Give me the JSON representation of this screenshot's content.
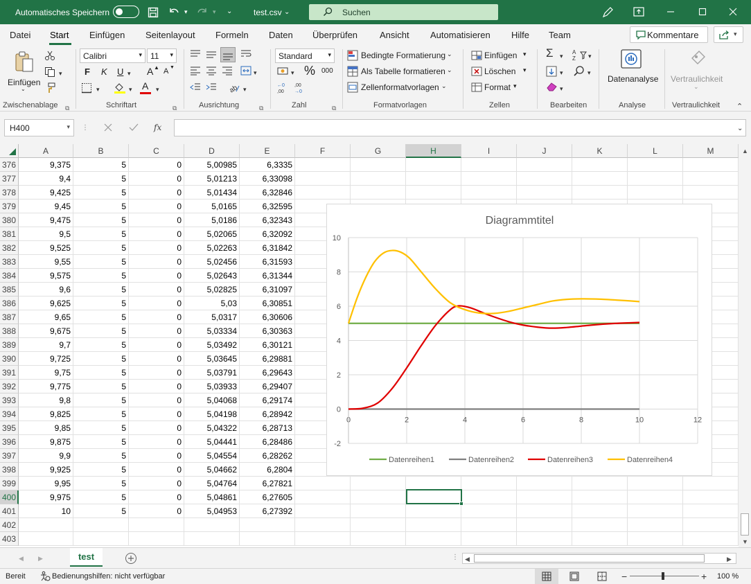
{
  "titlebar": {
    "autosave_label": "Automatisches Speichern",
    "filename": "test.csv",
    "search_placeholder": "Suchen"
  },
  "menu": {
    "items": [
      "Datei",
      "Start",
      "Einfügen",
      "Seitenlayout",
      "Formeln",
      "Daten",
      "Überprüfen",
      "Ansicht",
      "Automatisieren",
      "Hilfe",
      "Team"
    ],
    "active": "Start",
    "comments_label": "Kommentare"
  },
  "ribbon": {
    "clipboard": {
      "paste_label": "Einfügen",
      "group_label": "Zwischenablage"
    },
    "font": {
      "name": "Calibri",
      "size": "11",
      "bold": "F",
      "italic": "K",
      "underline": "U",
      "grow": "A",
      "shrink": "A",
      "color_letter": "A",
      "group_label": "Schriftart"
    },
    "alignment": {
      "group_label": "Ausrichtung"
    },
    "number": {
      "format": "Standard",
      "percent": "%",
      "thousands": "000",
      "group_label": "Zahl"
    },
    "styles": {
      "conditional": "Bedingte Formatierung",
      "as_table": "Als Tabelle formatieren",
      "cell_styles": "Zellenformatvorlagen",
      "group_label": "Formatvorlagen"
    },
    "cells": {
      "insert": "Einfügen",
      "delete": "Löschen",
      "format": "Format",
      "group_label": "Zellen"
    },
    "editing": {
      "group_label": "Bearbeiten"
    },
    "analysis": {
      "button_label": "Datenanalyse",
      "group_label": "Analyse"
    },
    "sensitivity": {
      "button_label": "Vertraulichkeit",
      "group_label": "Vertraulichkeit"
    }
  },
  "formula_bar": {
    "name_box": "H400",
    "fx": "fx",
    "content": ""
  },
  "grid": {
    "columns": [
      "A",
      "B",
      "C",
      "D",
      "E",
      "F",
      "G",
      "H",
      "I",
      "J",
      "K",
      "L",
      "M"
    ],
    "selected_column": "H",
    "selected_row": "400",
    "rows": [
      {
        "n": "376",
        "A": "9,375",
        "B": "5",
        "C": "0",
        "D": "5,00985",
        "E": "6,3335"
      },
      {
        "n": "377",
        "A": "9,4",
        "B": "5",
        "C": "0",
        "D": "5,01213",
        "E": "6,33098"
      },
      {
        "n": "378",
        "A": "9,425",
        "B": "5",
        "C": "0",
        "D": "5,01434",
        "E": "6,32846"
      },
      {
        "n": "379",
        "A": "9,45",
        "B": "5",
        "C": "0",
        "D": "5,0165",
        "E": "6,32595"
      },
      {
        "n": "380",
        "A": "9,475",
        "B": "5",
        "C": "0",
        "D": "5,0186",
        "E": "6,32343"
      },
      {
        "n": "381",
        "A": "9,5",
        "B": "5",
        "C": "0",
        "D": "5,02065",
        "E": "6,32092"
      },
      {
        "n": "382",
        "A": "9,525",
        "B": "5",
        "C": "0",
        "D": "5,02263",
        "E": "6,31842"
      },
      {
        "n": "383",
        "A": "9,55",
        "B": "5",
        "C": "0",
        "D": "5,02456",
        "E": "6,31593"
      },
      {
        "n": "384",
        "A": "9,575",
        "B": "5",
        "C": "0",
        "D": "5,02643",
        "E": "6,31344"
      },
      {
        "n": "385",
        "A": "9,6",
        "B": "5",
        "C": "0",
        "D": "5,02825",
        "E": "6,31097"
      },
      {
        "n": "386",
        "A": "9,625",
        "B": "5",
        "C": "0",
        "D": "5,03",
        "E": "6,30851"
      },
      {
        "n": "387",
        "A": "9,65",
        "B": "5",
        "C": "0",
        "D": "5,0317",
        "E": "6,30606"
      },
      {
        "n": "388",
        "A": "9,675",
        "B": "5",
        "C": "0",
        "D": "5,03334",
        "E": "6,30363"
      },
      {
        "n": "389",
        "A": "9,7",
        "B": "5",
        "C": "0",
        "D": "5,03492",
        "E": "6,30121"
      },
      {
        "n": "390",
        "A": "9,725",
        "B": "5",
        "C": "0",
        "D": "5,03645",
        "E": "6,29881"
      },
      {
        "n": "391",
        "A": "9,75",
        "B": "5",
        "C": "0",
        "D": "5,03791",
        "E": "6,29643"
      },
      {
        "n": "392",
        "A": "9,775",
        "B": "5",
        "C": "0",
        "D": "5,03933",
        "E": "6,29407"
      },
      {
        "n": "393",
        "A": "9,8",
        "B": "5",
        "C": "0",
        "D": "5,04068",
        "E": "6,29174"
      },
      {
        "n": "394",
        "A": "9,825",
        "B": "5",
        "C": "0",
        "D": "5,04198",
        "E": "6,28942"
      },
      {
        "n": "395",
        "A": "9,85",
        "B": "5",
        "C": "0",
        "D": "5,04322",
        "E": "6,28713"
      },
      {
        "n": "396",
        "A": "9,875",
        "B": "5",
        "C": "0",
        "D": "5,04441",
        "E": "6,28486"
      },
      {
        "n": "397",
        "A": "9,9",
        "B": "5",
        "C": "0",
        "D": "5,04554",
        "E": "6,28262"
      },
      {
        "n": "398",
        "A": "9,925",
        "B": "5",
        "C": "0",
        "D": "5,04662",
        "E": "6,2804"
      },
      {
        "n": "399",
        "A": "9,95",
        "B": "5",
        "C": "0",
        "D": "5,04764",
        "E": "6,27821"
      },
      {
        "n": "400",
        "A": "9,975",
        "B": "5",
        "C": "0",
        "D": "5,04861",
        "E": "6,27605"
      },
      {
        "n": "401",
        "A": "10",
        "B": "5",
        "C": "0",
        "D": "5,04953",
        "E": "6,27392"
      },
      {
        "n": "402",
        "A": "",
        "B": "",
        "C": "",
        "D": "",
        "E": ""
      },
      {
        "n": "403",
        "A": "",
        "B": "",
        "C": "",
        "D": "",
        "E": ""
      }
    ]
  },
  "chart_data": {
    "type": "line",
    "title": "Diagrammtitel",
    "xlabel": "",
    "ylabel": "",
    "xlim": [
      0,
      12
    ],
    "ylim": [
      -2,
      10
    ],
    "xticks": [
      0,
      2,
      4,
      6,
      8,
      10,
      12
    ],
    "yticks": [
      -2,
      0,
      2,
      4,
      6,
      8,
      10
    ],
    "grid": true,
    "legend": "bottom",
    "series": [
      {
        "name": "Datenreihen1",
        "color": "#70ad47",
        "x": [
          0,
          10
        ],
        "y": [
          5,
          5
        ]
      },
      {
        "name": "Datenreihen2",
        "color": "#7f7f7f",
        "x": [
          0,
          10
        ],
        "y": [
          0,
          0
        ]
      },
      {
        "name": "Datenreihen3",
        "color": "#e00000",
        "x": [
          0,
          0.5,
          1,
          1.5,
          2,
          2.5,
          3,
          3.5,
          3.8,
          4.2,
          4.8,
          5.5,
          6,
          6.5,
          7,
          7.5,
          8,
          8.5,
          9,
          9.5,
          10
        ],
        "y": [
          0,
          0.05,
          0.35,
          1.2,
          2.4,
          3.7,
          4.9,
          5.8,
          6.02,
          5.9,
          5.5,
          5.1,
          4.9,
          4.78,
          4.72,
          4.76,
          4.84,
          4.92,
          4.98,
          5.02,
          5.05
        ]
      },
      {
        "name": "Datenreihen4",
        "color": "#ffc000",
        "x": [
          0,
          0.3,
          0.6,
          0.9,
          1.2,
          1.5,
          1.8,
          2.1,
          2.5,
          3,
          3.5,
          4,
          4.5,
          5,
          5.5,
          6,
          6.5,
          7,
          7.5,
          8,
          8.5,
          9,
          9.5,
          10
        ],
        "y": [
          5,
          6.5,
          7.7,
          8.6,
          9.1,
          9.25,
          9.15,
          8.8,
          8.0,
          7.0,
          6.2,
          5.8,
          5.6,
          5.58,
          5.7,
          5.9,
          6.1,
          6.3,
          6.4,
          6.43,
          6.42,
          6.38,
          6.33,
          6.27
        ]
      }
    ]
  },
  "sheets": {
    "tabs": [
      "test"
    ],
    "active": "test"
  },
  "status": {
    "ready": "Bereit",
    "accessibility": "Bedienungshilfen: nicht verfügbar",
    "zoom": "100 %"
  }
}
